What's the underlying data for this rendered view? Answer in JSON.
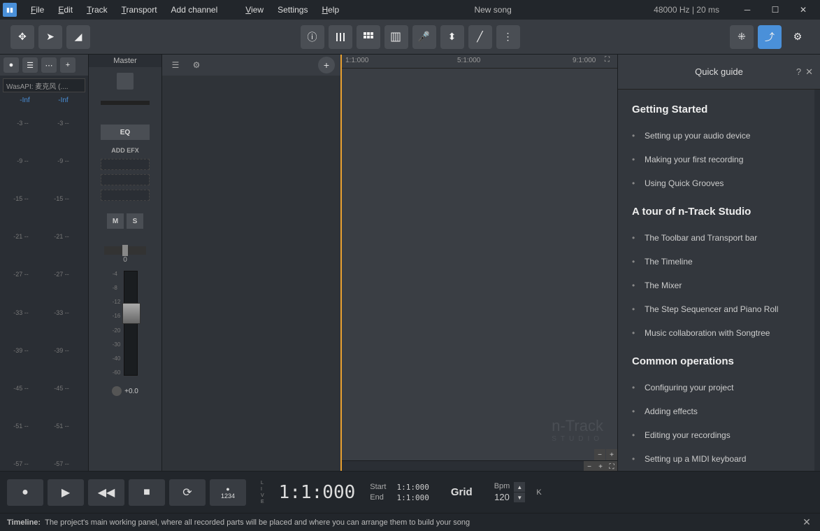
{
  "menubar": {
    "items": [
      "File",
      "Edit",
      "Track",
      "Transport",
      "Add channel",
      "View",
      "Settings",
      "Help"
    ],
    "title": "New song",
    "status": "48000 Hz | 20 ms"
  },
  "leftpanel": {
    "input": "WasAPI: 麦克风 (....",
    "inf_l": "-Inf",
    "inf_r": "-Inf",
    "scale": [
      "-3 --",
      "-9 --",
      "-15 --",
      "-21 --",
      "-27 --",
      "-33 --",
      "-39 --",
      "-45 --",
      "-51 --",
      "-57 --"
    ]
  },
  "master": {
    "title": "Master",
    "eq": "EQ",
    "addefx": "ADD EFX",
    "m": "M",
    "s": "S",
    "zero": "0",
    "fader_val": "+0.0",
    "fader_scale": [
      "-4",
      "-8",
      "-12",
      "-16",
      "-20",
      "-30",
      "-40",
      "-60"
    ]
  },
  "ruler": {
    "m1": "1:1:000",
    "m2": "5:1:000",
    "m3": "9:1:000"
  },
  "watermark": {
    "title": "n-Track",
    "sub": "STUDIO"
  },
  "transport": {
    "time": "1:1:000",
    "start_label": "Start",
    "start_val": "1:1:000",
    "end_label": "End",
    "end_val": "1:1:000",
    "grid": "Grid",
    "bpm_label": "Bpm",
    "bpm_val": "120",
    "k": "K",
    "metronome": "1234"
  },
  "statusbar": {
    "label": "Timeline:",
    "text": "The project's main working panel, where all recorded parts will be placed and where you can arrange them to build your song"
  },
  "guide": {
    "title": "Quick guide",
    "sections": [
      {
        "heading": "Getting Started",
        "items": [
          "Setting up your audio device",
          "Making your first recording",
          "Using Quick Grooves"
        ]
      },
      {
        "heading": "A tour of n-Track Studio",
        "items": [
          "The Toolbar and Transport bar",
          "The Timeline",
          "The Mixer",
          "The Step Sequencer and Piano Roll",
          "Music collaboration with Songtree"
        ]
      },
      {
        "heading": "Common operations",
        "items": [
          "Configuring your project",
          "Adding effects",
          "Editing your recordings",
          "Setting up a MIDI keyboard"
        ]
      }
    ]
  }
}
